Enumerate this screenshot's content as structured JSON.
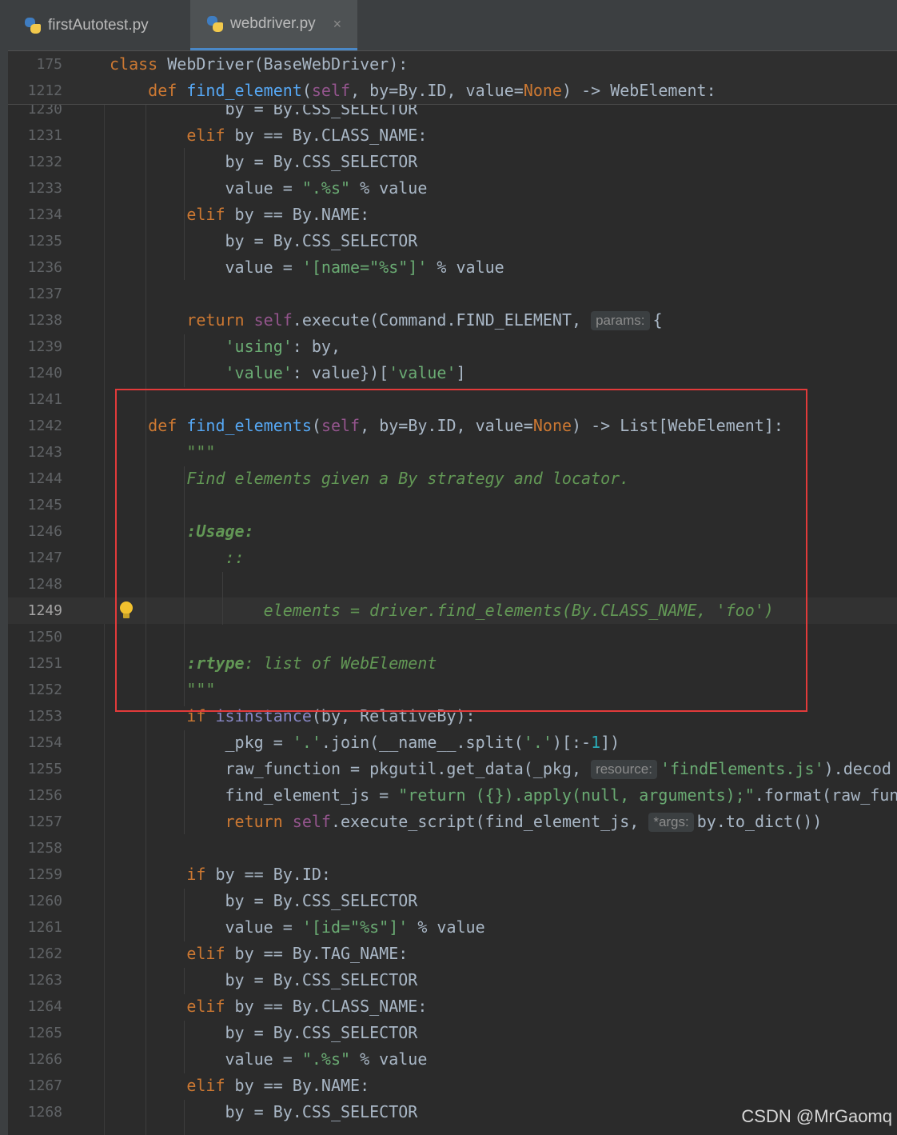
{
  "tabs": [
    {
      "label": "firstAutotest.py",
      "active": false
    },
    {
      "label": "webdriver.py",
      "active": true,
      "close": "×"
    }
  ],
  "sticky": [
    {
      "ln": "175",
      "code": "class WebDriver(BaseWebDriver):"
    },
    {
      "ln": "1212",
      "code": "    def find_element(self, by=By.ID, value=None) -> WebElement:"
    }
  ],
  "lines": [
    {
      "ln": "1230",
      "code": "            by = By.CSS_SELECTOR"
    },
    {
      "ln": "1231",
      "code": "        elif by == By.CLASS_NAME:"
    },
    {
      "ln": "1232",
      "code": "            by = By.CSS_SELECTOR"
    },
    {
      "ln": "1233",
      "code": "            value = \".%s\" % value"
    },
    {
      "ln": "1234",
      "code": "        elif by == By.NAME:"
    },
    {
      "ln": "1235",
      "code": "            by = By.CSS_SELECTOR"
    },
    {
      "ln": "1236",
      "code": "            value = '[name=\"%s\"]' % value"
    },
    {
      "ln": "1237",
      "code": ""
    },
    {
      "ln": "1238",
      "code": "        return self.execute(Command.FIND_ELEMENT, {"
    },
    {
      "ln": "1239",
      "code": "            'using': by,"
    },
    {
      "ln": "1240",
      "code": "            'value': value})['value']"
    },
    {
      "ln": "1241",
      "code": ""
    },
    {
      "ln": "1242",
      "code": "    def find_elements(self, by=By.ID, value=None) -> List[WebElement]:"
    },
    {
      "ln": "1243",
      "code": "        \"\"\""
    },
    {
      "ln": "1244",
      "code": "        Find elements given a By strategy and locator."
    },
    {
      "ln": "1245",
      "code": ""
    },
    {
      "ln": "1246",
      "code": "        :Usage:"
    },
    {
      "ln": "1247",
      "code": "            ::"
    },
    {
      "ln": "1248",
      "code": ""
    },
    {
      "ln": "1249",
      "code": "                elements = driver.find_elements(By.CLASS_NAME, 'foo')"
    },
    {
      "ln": "1250",
      "code": ""
    },
    {
      "ln": "1251",
      "code": "        :rtype: list of WebElement"
    },
    {
      "ln": "1252",
      "code": "        \"\"\""
    },
    {
      "ln": "1253",
      "code": "        if isinstance(by, RelativeBy):"
    },
    {
      "ln": "1254",
      "code": "            _pkg = '.'.join(__name__.split('.')[:-1])"
    },
    {
      "ln": "1255",
      "code": "            raw_function = pkgutil.get_data(_pkg, 'findElements.js').decod"
    },
    {
      "ln": "1256",
      "code": "            find_element_js = \"return ({}).apply(null, arguments);\".format(raw_fun"
    },
    {
      "ln": "1257",
      "code": "            return self.execute_script(find_element_js, by.to_dict())"
    },
    {
      "ln": "1258",
      "code": ""
    },
    {
      "ln": "1259",
      "code": "        if by == By.ID:"
    },
    {
      "ln": "1260",
      "code": "            by = By.CSS_SELECTOR"
    },
    {
      "ln": "1261",
      "code": "            value = '[id=\"%s\"]' % value"
    },
    {
      "ln": "1262",
      "code": "        elif by == By.TAG_NAME:"
    },
    {
      "ln": "1263",
      "code": "            by = By.CSS_SELECTOR"
    },
    {
      "ln": "1264",
      "code": "        elif by == By.CLASS_NAME:"
    },
    {
      "ln": "1265",
      "code": "            by = By.CSS_SELECTOR"
    },
    {
      "ln": "1266",
      "code": "            value = \".%s\" % value"
    },
    {
      "ln": "1267",
      "code": "        elif by == By.NAME:"
    },
    {
      "ln": "1268",
      "code": "            by = By.CSS_SELECTOR"
    }
  ],
  "hints": {
    "params": "params:",
    "resource": "resource:",
    "args": "*args:"
  },
  "current_line": "1249",
  "watermark": "CSDN @MrGaomq",
  "colors": {
    "keyword": "#cc7832",
    "function": "#56a8f5",
    "self": "#94558d",
    "string": "#6aab73",
    "docstring": "#629755",
    "highlight_box": "#e23a3a"
  }
}
